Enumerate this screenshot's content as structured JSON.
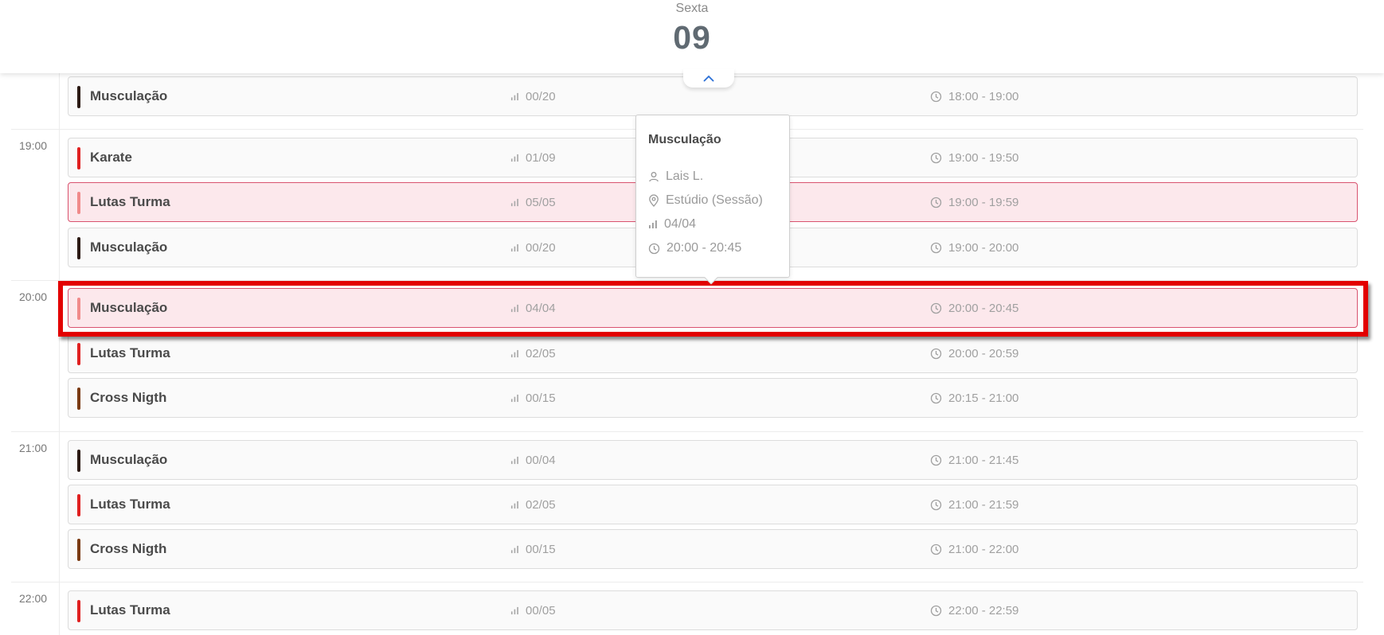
{
  "header": {
    "weekday": "Sexta",
    "day_number": "09"
  },
  "hours": [
    "19:00",
    "20:00",
    "21:00",
    "22:00"
  ],
  "rows": [
    {
      "name": "Musculação",
      "capacity": "00/20",
      "time": "18:00 - 19:00",
      "color": "#2b1a14",
      "full": false
    },
    {
      "name": "Karate",
      "capacity": "01/09",
      "time": "19:00 - 19:50",
      "color": "#e02020",
      "full": false
    },
    {
      "name": "Lutas Turma",
      "capacity": "05/05",
      "time": "19:00 - 19:59",
      "color": "#f08a8a",
      "full": true
    },
    {
      "name": "Musculação",
      "capacity": "00/20",
      "time": "19:00 - 20:00",
      "color": "#2b1a14",
      "full": false
    },
    {
      "name": "Musculação",
      "capacity": "04/04",
      "time": "20:00 - 20:45",
      "color": "#f08a8a",
      "full": true
    },
    {
      "name": "Lutas Turma",
      "capacity": "02/05",
      "time": "20:00 - 20:59",
      "color": "#e02020",
      "full": false
    },
    {
      "name": "Cross Nigth",
      "capacity": "00/15",
      "time": "20:15 - 21:00",
      "color": "#7a3a12",
      "full": false
    },
    {
      "name": "Musculação",
      "capacity": "00/04",
      "time": "21:00 - 21:45",
      "color": "#2b1a14",
      "full": false
    },
    {
      "name": "Lutas Turma",
      "capacity": "02/05",
      "time": "21:00 - 21:59",
      "color": "#e02020",
      "full": false
    },
    {
      "name": "Cross Nigth",
      "capacity": "00/15",
      "time": "21:00 - 22:00",
      "color": "#7a3a12",
      "full": false
    },
    {
      "name": "Lutas Turma",
      "capacity": "00/05",
      "time": "22:00 - 22:59",
      "color": "#e02020",
      "full": false
    }
  ],
  "tooltip": {
    "title": "Musculação",
    "instructor": "Lais L.",
    "location": "Estúdio (Sessão)",
    "capacity": "04/04",
    "time": "20:00 - 20:45"
  },
  "icons": {
    "collapse": "chevron-up-icon",
    "capacity": "bar-chart-icon",
    "time": "clock-icon",
    "instructor": "user-icon",
    "location": "map-pin-icon"
  }
}
